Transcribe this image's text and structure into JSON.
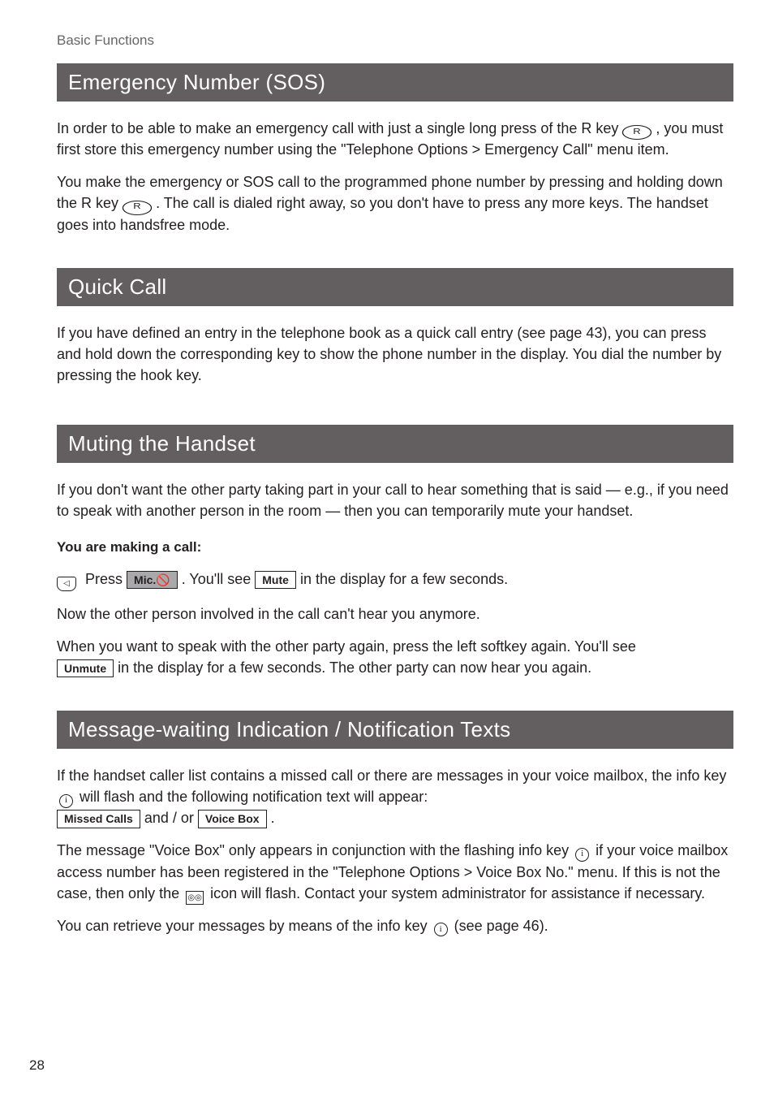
{
  "breadcrumb": "Basic Functions",
  "sections": {
    "emergency": {
      "title": "Emergency Number (SOS)",
      "para1_a": "In order to be able to make an emergency call with just a single long press of the R key ",
      "para1_b": " , you must first store this emergency number using the \"Telephone Options > Emergency Call\" menu item.",
      "para2_a": "You make the emergency or SOS call to the programmed phone number by pressing and holding down the R key ",
      "para2_b": " . The call is dialed right away, so you don't have to press any more keys. The handset goes into handsfree mode."
    },
    "quickcall": {
      "title": "Quick Call",
      "para1": "If you have defined an entry in the telephone book as a quick call entry (see page 43), you can press and hold down the corresponding key to show the phone number in the display. You dial the number by pressing the hook key."
    },
    "muting": {
      "title": "Muting the Handset",
      "para1": "If you don't want the other party taking part in your call to hear something that is said — e.g., if you need to speak with another person in the room — then you can temporarily mute your handset.",
      "bold_line": "You are making a call:",
      "press_word": "Press",
      "mic_label": "Mic.🚫",
      "youll_see": ". You'll see",
      "mute_label": "Mute",
      "in_display": "in the display for a few seconds.",
      "para2": "Now the other person involved in the call can't hear you anymore.",
      "para3": "When you want to speak with the other party again, press the left softkey again. You'll see",
      "unmute_label": "Unmute",
      "para3_end": "in the display for a few seconds. The other party can now hear you again."
    },
    "mwi": {
      "title": "Message-waiting Indication / Notification Texts",
      "para1_a": "If the handset caller list contains a missed call or there are messages in your voice mailbox, the info key ",
      "para1_b": " will flash and the following notification text will appear:",
      "missed_calls_label": "Missed Calls",
      "and_or": " and / or ",
      "voice_box_label": "Voice Box",
      "period": " .",
      "para2_a": "The message \"Voice Box\" only appears in conjunction with the flashing info key ",
      "para2_b": " if your voice mailbox access number has been registered in the \"Telephone Options > Voice Box No.\" menu. If this is not the case, then only the ",
      "para2_c": " icon will flash. Contact your system administrator for assistance if necessary.",
      "para3_a": "You can retrieve your messages by means of the info key ",
      "para3_b": " (see page 46)."
    }
  },
  "icons": {
    "r_key": "R",
    "info_key": "i",
    "tape": "◎◎"
  },
  "page_number": "28"
}
